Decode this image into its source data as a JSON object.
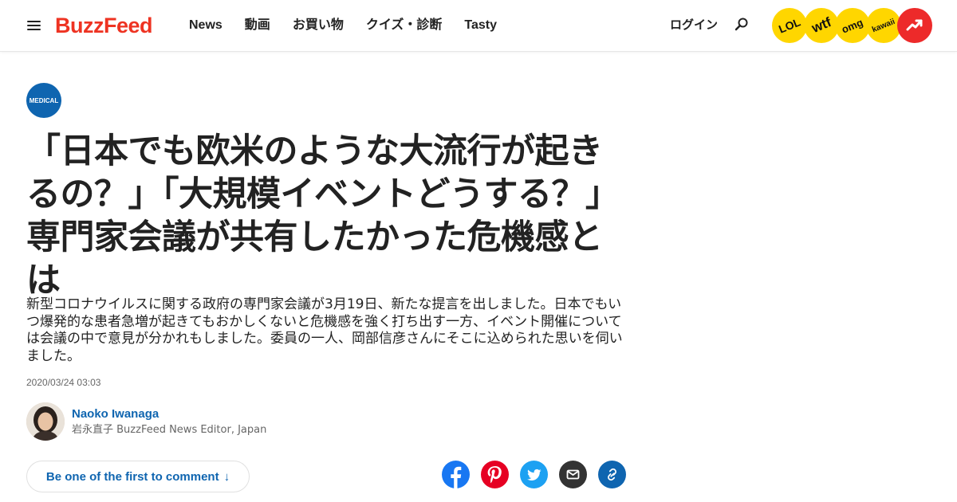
{
  "header": {
    "logo": "BuzzFeed",
    "nav": [
      "News",
      "動画",
      "お買い物",
      "クイズ・診断",
      "Tasty"
    ],
    "login": "ログイン",
    "badges": [
      "LOL",
      "wtf",
      "omg",
      "kawaii"
    ],
    "logo_color": "#ee3322"
  },
  "article": {
    "category": "MEDICAL",
    "title": "「日本でも欧米のような大流行が起きるの？」「大規模イベントどうする？」 専門家会議が共有したかった危機感とは",
    "description": "新型コロナウイルスに関する政府の専門家会議が3月19日、新たな提言を出しました。日本でもいつ爆発的な患者急増が起きてもおかしくないと危機感を強く打ち出す一方、イベント開催については会議の中で意見が分かれもしました。委員の一人、岡部信彦さんにそこに込められた思いを伺いました。",
    "timestamp": "2020/03/24 03:03",
    "author_name": "Naoko Iwanaga",
    "author_title": "岩永直子 BuzzFeed News Editor, Japan",
    "comment_label": "Be one of the first to comment",
    "comment_arrow": "↓"
  },
  "share_icons": [
    "facebook-icon",
    "pinterest-icon",
    "twitter-icon",
    "mail-icon",
    "link-icon"
  ],
  "colors": {
    "accent_blue": "#0f65b0",
    "badge_yellow": "#ffd600",
    "trending_red": "#ed2a2a"
  }
}
